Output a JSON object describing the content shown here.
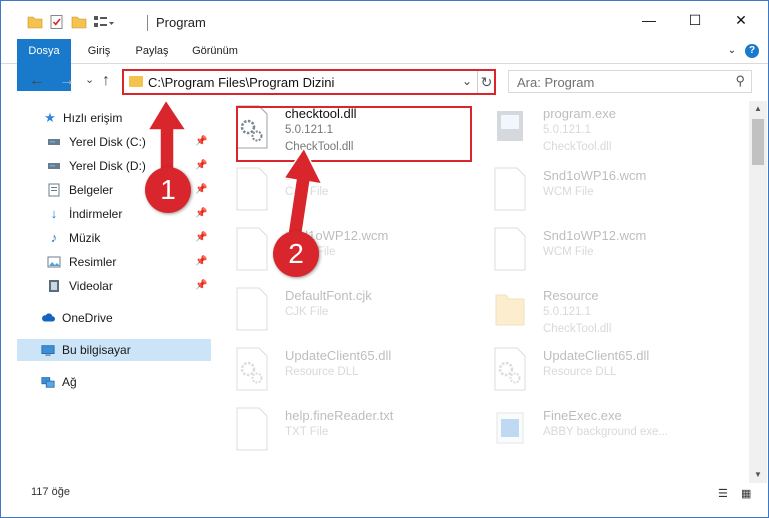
{
  "window": {
    "title": "Program",
    "minimize_label": "—",
    "maximize_label": "☐",
    "close_label": "✕"
  },
  "ribbon": {
    "tabs": [
      "Dosya",
      "Giriş",
      "Paylaş",
      "Görünüm"
    ],
    "help_label": "?"
  },
  "address": {
    "path": "C:\\Program Files\\Program Dizini",
    "dropdown_glyph": "⌄",
    "refresh_glyph": "↻"
  },
  "search": {
    "placeholder": "Ara: Program",
    "icon_glyph": "⚲"
  },
  "nav": {
    "back": "←",
    "forward": "→",
    "recent": "⌄",
    "up": "↑"
  },
  "sidebar": {
    "quick_access": "Hızlı erişim",
    "items": [
      {
        "label": "Yerel Disk (C:)",
        "icon": "drive-icon"
      },
      {
        "label": "Yerel Disk (D:)",
        "icon": "drive-icon"
      },
      {
        "label": "Belgeler",
        "icon": "documents-icon"
      },
      {
        "label": "İndirmeler",
        "icon": "download-icon"
      },
      {
        "label": "Müzik",
        "icon": "music-icon"
      },
      {
        "label": "Resimler",
        "icon": "pictures-icon"
      },
      {
        "label": "Videolar",
        "icon": "videos-icon"
      }
    ],
    "onedrive": "OneDrive",
    "this_pc": "Bu bilgisayar",
    "network": "Ağ"
  },
  "files": [
    {
      "name": "checktool.dll",
      "line2": "5.0.121.1",
      "line3": "CheckTool.dll",
      "icon": "dll-icon"
    },
    {
      "name": "program.exe",
      "line2": "5.0.121.1",
      "line3": "CheckTool.dll",
      "icon": "exe-icon"
    },
    {
      "name": "ca.cjk",
      "line2": "CJK File",
      "line3": "",
      "icon": "file-icon"
    },
    {
      "name": "Snd1oWP16.wcm",
      "line2": "WCM File",
      "line3": "",
      "icon": "file-icon"
    },
    {
      "name": "Snd1oWP12.wcm",
      "line2": "WCM File",
      "line3": "",
      "icon": "file-icon"
    },
    {
      "name": "Snd1oWP12.wcm",
      "line2": "WCM File",
      "line3": "",
      "icon": "file-icon"
    },
    {
      "name": "DefaultFont.cjk",
      "line2": "CJK File",
      "line3": "",
      "icon": "file-icon"
    },
    {
      "name": "Resource",
      "line2": "5.0.121.1",
      "line3": "CheckTool.dll",
      "icon": "folder-icon"
    },
    {
      "name": "UpdateClient65.dll",
      "line2": "Resource DLL",
      "line3": "",
      "icon": "dll-icon"
    },
    {
      "name": "UpdateClient65.dll",
      "line2": "Resource DLL",
      "line3": "",
      "icon": "dll-icon"
    },
    {
      "name": "help.fineReader.txt",
      "line2": "TXT File",
      "line3": "",
      "icon": "file-icon"
    },
    {
      "name": "FineExec.exe",
      "line2": "ABBY background exe...",
      "line3": "",
      "icon": "exe-icon"
    }
  ],
  "status": {
    "count": "117 öğe"
  },
  "callouts": [
    "1",
    "2"
  ],
  "colors": {
    "accent": "#1979ca",
    "highlight": "#d9262c",
    "selection": "#cce4f7"
  }
}
